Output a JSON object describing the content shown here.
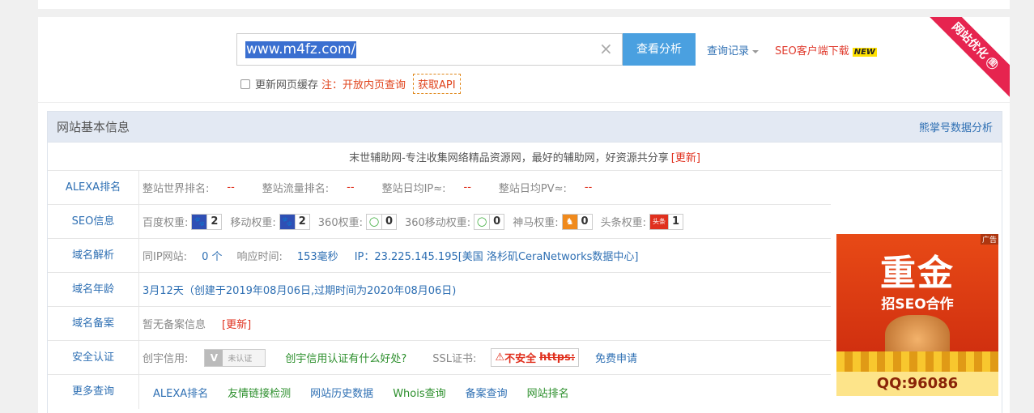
{
  "search": {
    "query": "www.m4fz.com/",
    "button": "查看分析",
    "history": "查询记录",
    "seo_download": "SEO客户端下载",
    "new_badge": "NEW",
    "refresh_cache": "更新网页缓存",
    "note": "注：开放内页查询",
    "api": "获取API"
  },
  "ribbon": {
    "text": "网站优化",
    "mark": "图"
  },
  "panel": {
    "title": "网站基本信息",
    "right_link": "熊掌号数据分析",
    "description": "末世辅助网-专注收集网络精品资源网，最好的辅助网，好资源共分享",
    "update": "[更新]"
  },
  "alexa": {
    "label": "ALEXA排名",
    "world": "整站世界排名:",
    "world_val": "--",
    "traffic": "整站流量排名:",
    "traffic_val": "--",
    "ip": "整站日均IP≈:",
    "ip_val": "--",
    "pv": "整站日均PV≈:",
    "pv_val": "--"
  },
  "seo": {
    "label": "SEO信息",
    "items": [
      {
        "name": "百度权重:",
        "value": "2",
        "icon": "baidu-paw-icon"
      },
      {
        "name": "移动权重:",
        "value": "2",
        "icon": "baidu-paw-icon"
      },
      {
        "name": "360权重:",
        "value": "0",
        "icon": "so360-icon"
      },
      {
        "name": "360移动权重:",
        "value": "0",
        "icon": "so360-icon"
      },
      {
        "name": "神马权重:",
        "value": "0",
        "icon": "shenma-icon"
      },
      {
        "name": "头条权重:",
        "value": "1",
        "icon": "toutiao-icon"
      }
    ]
  },
  "dns": {
    "label": "域名解析",
    "same_ip": "同IP网站:",
    "same_ip_val": "0 个",
    "response": "响应时间:",
    "response_val": "153毫秒",
    "ip": "IP：23.225.145.195[美国 洛杉矶CeraNetworks数据中心]"
  },
  "age": {
    "label": "域名年龄",
    "text": "3月12天（创建于2019年08月06日,过期时间为2020年08月06日)"
  },
  "beian": {
    "label": "域名备案",
    "text": "暂无备案信息",
    "update": "[更新]"
  },
  "security": {
    "label": "安全认证",
    "credit": "创宇信用:",
    "cert_text": "未认证",
    "cert_v": "V",
    "credit_link": "创宇信用认证有什么好处?",
    "ssl": "SSL证书:",
    "ssl_badge": "不安全",
    "ssl_https": "https:",
    "free_apply": "免费申请"
  },
  "ad": {
    "tag": "广告",
    "big": "重金",
    "sub": "招SEO合作",
    "qq": "QQ:96086"
  },
  "more": {
    "label": "更多查询",
    "links": [
      "ALEXA排名",
      "友情链接检测",
      "网站历史数据",
      "Whois查询",
      "备案查询",
      "网站排名"
    ]
  }
}
